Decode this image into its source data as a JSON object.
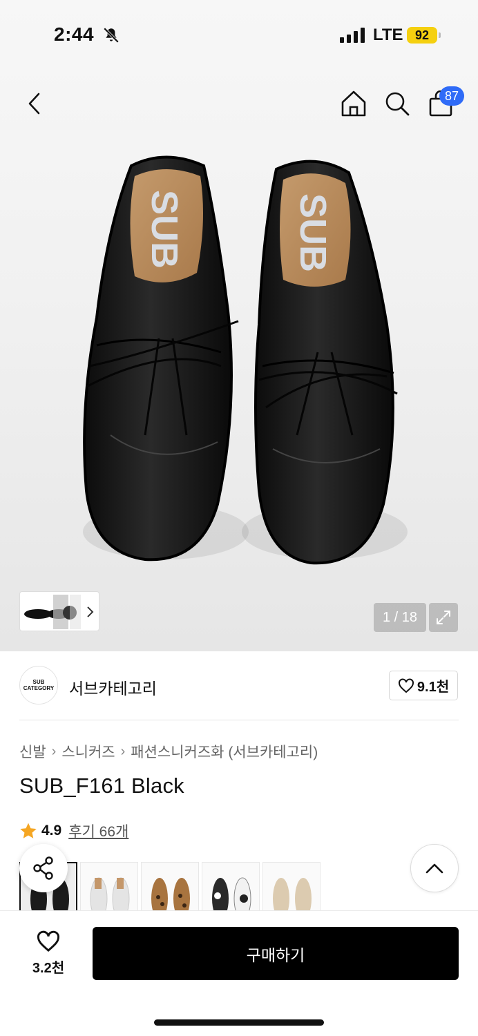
{
  "status_bar": {
    "time": "2:44",
    "network": "LTE",
    "battery": "92"
  },
  "nav": {
    "cart_count": "87"
  },
  "gallery": {
    "counter": "1 / 18"
  },
  "brand": {
    "logo_line1": "SUB",
    "logo_line2": "CATEGORY",
    "name": "서브카테고리",
    "likes": "9.1천"
  },
  "breadcrumb": [
    "신발",
    "스니커즈",
    "패션스니커즈화 (서브카테고리)"
  ],
  "product": {
    "title": "SUB_F161 Black",
    "rating": "4.9",
    "reviews_label": "후기 66개"
  },
  "color_options": [
    {
      "name": "black",
      "color": "#1b1b1b"
    },
    {
      "name": "white",
      "color": "#f1f1f1"
    },
    {
      "name": "leopard",
      "color": "#a8743f"
    },
    {
      "name": "cow",
      "color": "#2a2a2a"
    },
    {
      "name": "beige",
      "color": "#dccbb0"
    }
  ],
  "bottom_bar": {
    "likes": "3.2천",
    "buy_label": "구매하기"
  },
  "colors": {
    "badge_blue": "#2f6bf7",
    "battery_yellow": "#f5d00f",
    "star": "#f5a623",
    "buy_bg": "#000000"
  }
}
